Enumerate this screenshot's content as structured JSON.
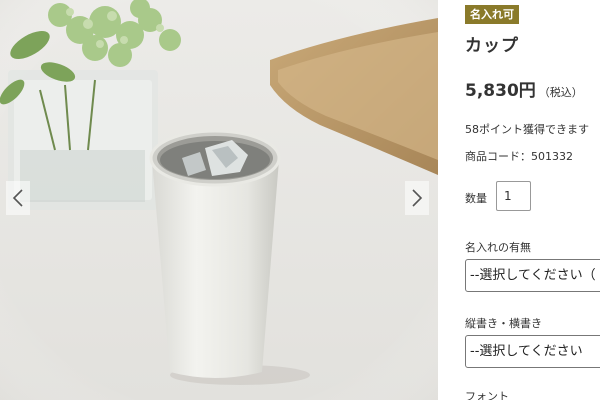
{
  "gallery": {
    "prev_icon": "chevron-left-icon",
    "next_icon": "chevron-right-icon"
  },
  "product": {
    "badge": "名入れ可",
    "badge_color": "#8a7a2a",
    "title": "カップ",
    "price": "5,830円",
    "tax_note": "（税込）",
    "points": "58ポイント獲得できます",
    "code": "商品コード：501332"
  },
  "quantity": {
    "label": "数量",
    "value": "1"
  },
  "options": {
    "engraving": {
      "label": "名入れの有無",
      "selected": "--選択してください（"
    },
    "orientation": {
      "label": "縦書き・横書き",
      "selected": "--選択してください"
    },
    "font": {
      "label": "フォント"
    }
  }
}
